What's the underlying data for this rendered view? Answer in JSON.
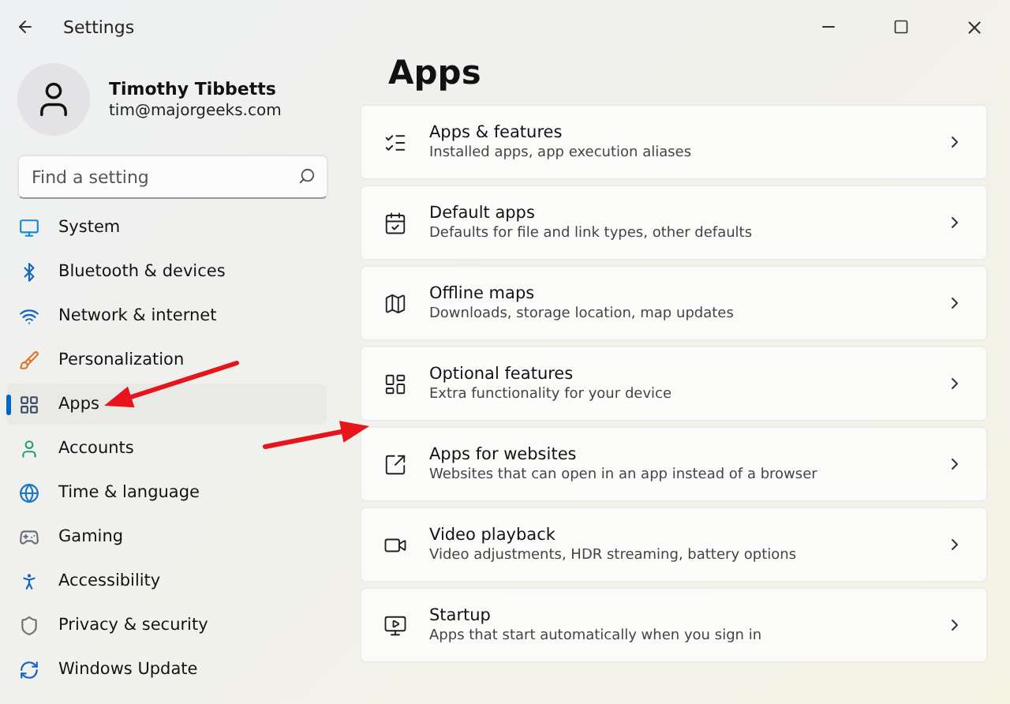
{
  "window": {
    "title": "Settings"
  },
  "profile": {
    "name": "Timothy Tibbetts",
    "email": "tim@majorgeeks.com"
  },
  "search": {
    "placeholder": "Find a setting"
  },
  "nav": [
    {
      "label": "System",
      "selected": false
    },
    {
      "label": "Bluetooth & devices",
      "selected": false
    },
    {
      "label": "Network & internet",
      "selected": false
    },
    {
      "label": "Personalization",
      "selected": false
    },
    {
      "label": "Apps",
      "selected": true
    },
    {
      "label": "Accounts",
      "selected": false
    },
    {
      "label": "Time & language",
      "selected": false
    },
    {
      "label": "Gaming",
      "selected": false
    },
    {
      "label": "Accessibility",
      "selected": false
    },
    {
      "label": "Privacy & security",
      "selected": false
    },
    {
      "label": "Windows Update",
      "selected": false
    }
  ],
  "page_title": "Apps",
  "cards": [
    {
      "title": "Apps & features",
      "subtitle": "Installed apps, app execution aliases"
    },
    {
      "title": "Default apps",
      "subtitle": "Defaults for file and link types, other defaults"
    },
    {
      "title": "Offline maps",
      "subtitle": "Downloads, storage location, map updates"
    },
    {
      "title": "Optional features",
      "subtitle": "Extra functionality for your device"
    },
    {
      "title": "Apps for websites",
      "subtitle": "Websites that can open in an app instead of a browser"
    },
    {
      "title": "Video playback",
      "subtitle": "Video adjustments, HDR streaming, battery options"
    },
    {
      "title": "Startup",
      "subtitle": "Apps that start automatically when you sign in"
    }
  ],
  "annotations": [
    {
      "kind": "arrow"
    },
    {
      "kind": "arrow"
    }
  ]
}
